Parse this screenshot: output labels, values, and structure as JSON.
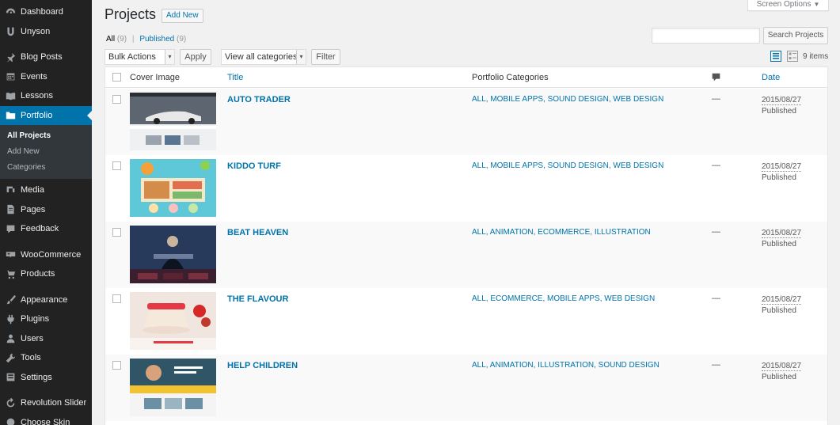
{
  "sidebar": {
    "items": [
      {
        "label": "Dashboard",
        "icon": "dashboard-icon"
      },
      {
        "label": "Unyson",
        "icon": "unyson-icon"
      },
      {
        "label": "Blog Posts",
        "icon": "pin-icon"
      },
      {
        "label": "Events",
        "icon": "calendar-icon"
      },
      {
        "label": "Lessons",
        "icon": "book-icon"
      },
      {
        "label": "Portfolio",
        "icon": "folder-icon"
      },
      {
        "label": "Media",
        "icon": "media-icon"
      },
      {
        "label": "Pages",
        "icon": "page-icon"
      },
      {
        "label": "Feedback",
        "icon": "comment-icon"
      },
      {
        "label": "WooCommerce",
        "icon": "woocommerce-icon"
      },
      {
        "label": "Products",
        "icon": "cart-icon"
      },
      {
        "label": "Appearance",
        "icon": "brush-icon"
      },
      {
        "label": "Plugins",
        "icon": "plugin-icon"
      },
      {
        "label": "Users",
        "icon": "user-icon"
      },
      {
        "label": "Tools",
        "icon": "wrench-icon"
      },
      {
        "label": "Settings",
        "icon": "settings-icon"
      },
      {
        "label": "Revolution Slider",
        "icon": "refresh-icon"
      },
      {
        "label": "Choose Skin",
        "icon": "skin-icon"
      }
    ],
    "submenu": [
      "All Projects",
      "Add New",
      "Categories"
    ]
  },
  "header": {
    "title": "Projects",
    "add_new": "Add New",
    "screen_options": "Screen Options",
    "screen_options_arrow": "▼"
  },
  "filters": {
    "all": "All",
    "all_count": "(9)",
    "separator": "|",
    "published": "Published",
    "published_count": "(9)",
    "search_button": "Search Projects",
    "bulk_actions": "Bulk Actions",
    "apply": "Apply",
    "view_categories": "View all categories",
    "filter": "Filter",
    "items_count": "9 items",
    "caret": "▾"
  },
  "table": {
    "headers": {
      "cover": "Cover Image",
      "title": "Title",
      "categories": "Portfolio Categories",
      "date": "Date"
    },
    "rows": [
      {
        "title": "AUTO TRADER",
        "categories": "ALL, MOBILE APPS, SOUND DESIGN, WEB DESIGN",
        "comments": "—",
        "date": "2015/08/27",
        "status": "Published"
      },
      {
        "title": "KIDDO TURF",
        "categories": "ALL, MOBILE APPS, SOUND DESIGN, WEB DESIGN",
        "comments": "—",
        "date": "2015/08/27",
        "status": "Published"
      },
      {
        "title": "BEAT HEAVEN",
        "categories": "ALL, ANIMATION, ECOMMERCE, ILLUSTRATION",
        "comments": "—",
        "date": "2015/08/27",
        "status": "Published"
      },
      {
        "title": "THE FLAVOUR",
        "categories": "ALL, ECOMMERCE, MOBILE APPS, WEB DESIGN",
        "comments": "—",
        "date": "2015/08/27",
        "status": "Published"
      },
      {
        "title": "HELP CHILDREN",
        "categories": "ALL, ANIMATION, ILLUSTRATION, SOUND DESIGN",
        "comments": "—",
        "date": "2015/08/27",
        "status": "Published"
      }
    ]
  },
  "colors": {
    "sidebar_bg": "#222222",
    "active": "#0073aa",
    "link": "#0073aa"
  }
}
